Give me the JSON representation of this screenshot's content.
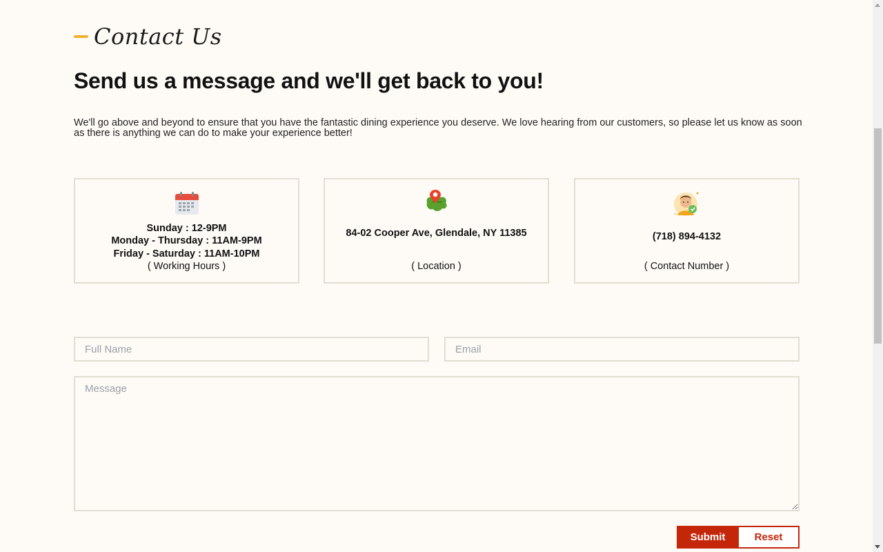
{
  "section_tag": "Contact Us",
  "headline": "Send us a message and we'll get back to you!",
  "intro": "We'll go above and beyond to ensure that you have the fantastic dining experience you deserve. We love hearing from our customers, so please let us know as soon as there is anything we can do to make your experience better!",
  "cards": {
    "hours": {
      "icon": "calendar-icon",
      "lines": [
        "Sunday : 12-9PM",
        "Monday - Thursday : 11AM-9PM",
        "Friday - Saturday : 11AM-10PM"
      ],
      "caption": "( Working Hours )"
    },
    "location": {
      "icon": "map-pin-icon",
      "value": "84-02 Cooper Ave, Glendale, NY 11385",
      "caption": "( Location )"
    },
    "phone": {
      "icon": "support-agent-icon",
      "value": "(718) 894-4132",
      "caption": "( Contact Number )"
    }
  },
  "form": {
    "name_placeholder": "Full Name",
    "email_placeholder": "Email",
    "message_placeholder": "Message",
    "submit_label": "Submit",
    "reset_label": "Reset"
  },
  "colors": {
    "background": "#fefbf7",
    "accent_dash": "#f2b031",
    "brand_red": "#c4260a",
    "border": "#e2ddd1"
  }
}
